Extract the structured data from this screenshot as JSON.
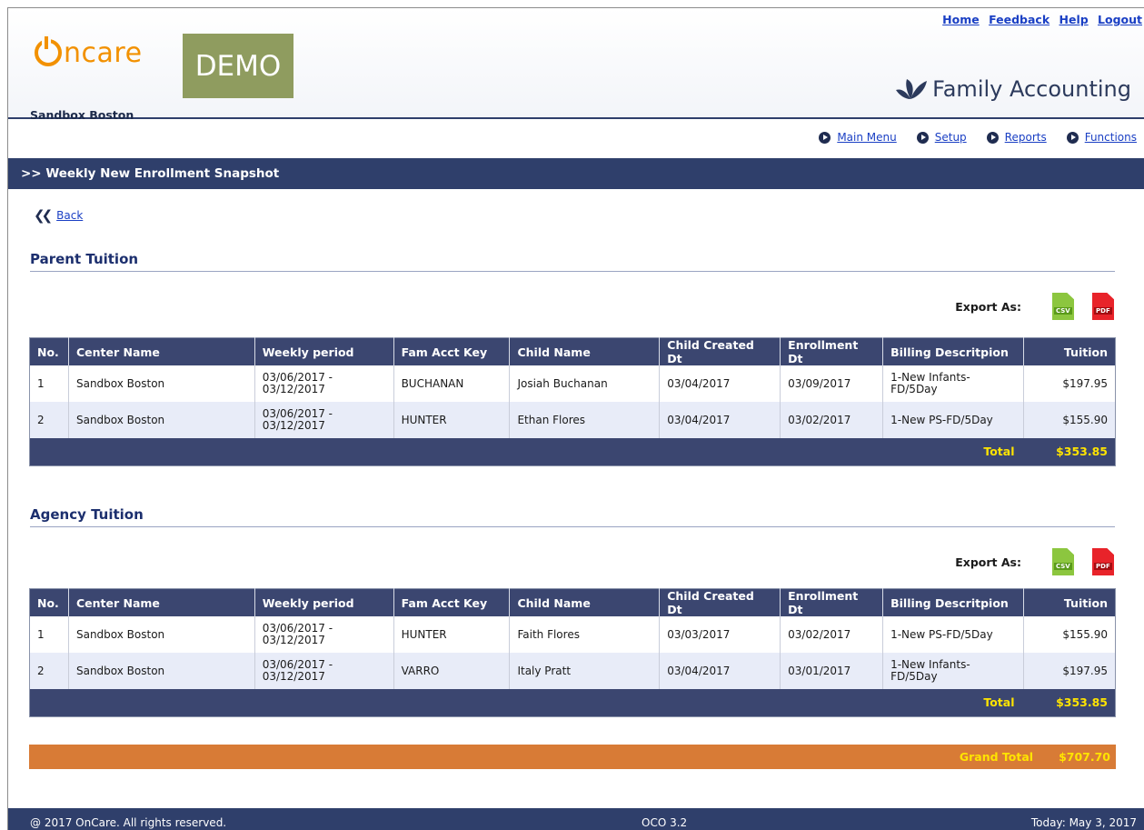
{
  "header": {
    "top_links": [
      "Home",
      "Feedback",
      "Help",
      "Logout"
    ],
    "logo_text": "ncare",
    "logo_badge": "DEMO",
    "center_name": "Sandbox Boston",
    "brand": "Family Accounting"
  },
  "nav": [
    "Main Menu",
    "Setup",
    "Reports",
    "Functions"
  ],
  "page_title": ">> Weekly New Enrollment Snapshot",
  "back_label": "Back",
  "export_label": "Export As:",
  "export_csv": "CSV",
  "export_pdf": "PDF",
  "columns": [
    "No.",
    "Center Name",
    "Weekly period",
    "Fam Acct Key",
    "Child Name",
    "Child Created Dt",
    "Enrollment Dt",
    "Billing Descritpion",
    "Tuition"
  ],
  "total_label": "Total",
  "parent": {
    "title": "Parent Tuition",
    "rows": [
      [
        "1",
        "Sandbox Boston",
        "03/06/2017 - 03/12/2017",
        "BUCHANAN",
        "Josiah Buchanan",
        "03/04/2017",
        "03/09/2017",
        "1-New Infants-FD/5Day",
        "$197.95"
      ],
      [
        "2",
        "Sandbox Boston",
        "03/06/2017 - 03/12/2017",
        "HUNTER",
        "Ethan Flores",
        "03/04/2017",
        "03/02/2017",
        "1-New PS-FD/5Day",
        "$155.90"
      ]
    ],
    "total": "$353.85"
  },
  "agency": {
    "title": "Agency Tuition",
    "rows": [
      [
        "1",
        "Sandbox Boston",
        "03/06/2017 - 03/12/2017",
        "HUNTER",
        "Faith Flores",
        "03/03/2017",
        "03/02/2017",
        "1-New PS-FD/5Day",
        "$155.90"
      ],
      [
        "2",
        "Sandbox Boston",
        "03/06/2017 - 03/12/2017",
        "VARRO",
        "Italy Pratt",
        "03/04/2017",
        "03/01/2017",
        "1-New Infants-FD/5Day",
        "$197.95"
      ]
    ],
    "total": "$353.85"
  },
  "grand_total": {
    "label": "Grand Total",
    "value": "$707.70"
  },
  "footer": {
    "copyright": "@ 2017 OnCare. All rights reserved.",
    "version": "OCO 3.2",
    "today": "Today: May 3, 2017"
  },
  "colors": {
    "navy": "#2f3f6b",
    "table_header": "#3b4670",
    "total_text": "#ffe400",
    "grand_total_bar": "#d87b36",
    "logo_orange": "#f29100",
    "demo_badge": "#8f9c5f",
    "link": "#1a3fc4"
  }
}
